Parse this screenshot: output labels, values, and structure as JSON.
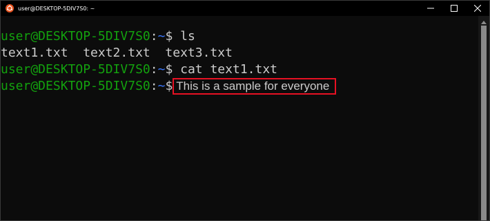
{
  "window": {
    "title": "user@DESKTOP-5DIV7S0: ~",
    "icon": "ubuntu-icon",
    "controls": [
      "minimize-icon",
      "maximize-icon",
      "close-icon"
    ]
  },
  "terminal": {
    "prompt_user": "user@DESKTOP-5DIV7S0",
    "prompt_colon": ":",
    "prompt_path": "~",
    "prompt_symbol": "$",
    "lines": [
      {
        "command": " ls"
      },
      {
        "output": "text1.txt  text2.txt  text3.txt"
      },
      {
        "command": " cat text1.txt"
      },
      {
        "highlighted_output": "This is a sample for everyone"
      }
    ]
  },
  "colors": {
    "background": "#0c0c0c",
    "prompt_user": "#13a10e",
    "prompt_path": "#3b78ff",
    "text": "#cccccc",
    "highlight_border": "#e81123"
  }
}
